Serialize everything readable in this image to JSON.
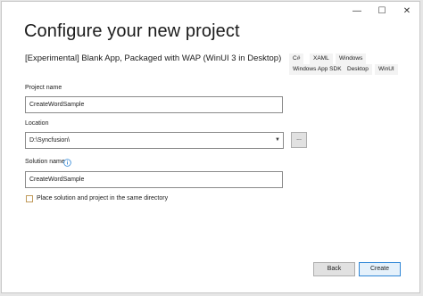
{
  "window": {
    "caption_buttons": {
      "minimize": "—",
      "maximize": "☐",
      "close": "✕"
    }
  },
  "page_title": "Configure your new project",
  "template": {
    "name": "[Experimental] Blank App, Packaged with WAP (WinUI 3 in Desktop)",
    "tags": [
      "C#",
      "XAML",
      "Windows",
      "Windows App SDK",
      "Desktop",
      "WinUI"
    ]
  },
  "form": {
    "project_name": {
      "label": "Project name",
      "value": "CreateWordSample"
    },
    "location": {
      "label": "Location",
      "value": "D:\\Syncfusion\\",
      "browse_label": "..."
    },
    "solution_name": {
      "label": "Solution name",
      "value": "CreateWordSample"
    },
    "same_dir": {
      "label": "Place solution and project in the same directory",
      "checked": false
    }
  },
  "buttons": {
    "back": "Back",
    "create": "Create"
  },
  "colors": {
    "accent": "#2f86d6",
    "checkbox_border": "#c09a5a",
    "info_icon": "#2f86d6"
  },
  "icons": {
    "minimize": "minimize-icon",
    "maximize": "maximize-icon",
    "close": "close-icon",
    "info": "info-icon",
    "dropdown": "chevron-down-icon"
  }
}
